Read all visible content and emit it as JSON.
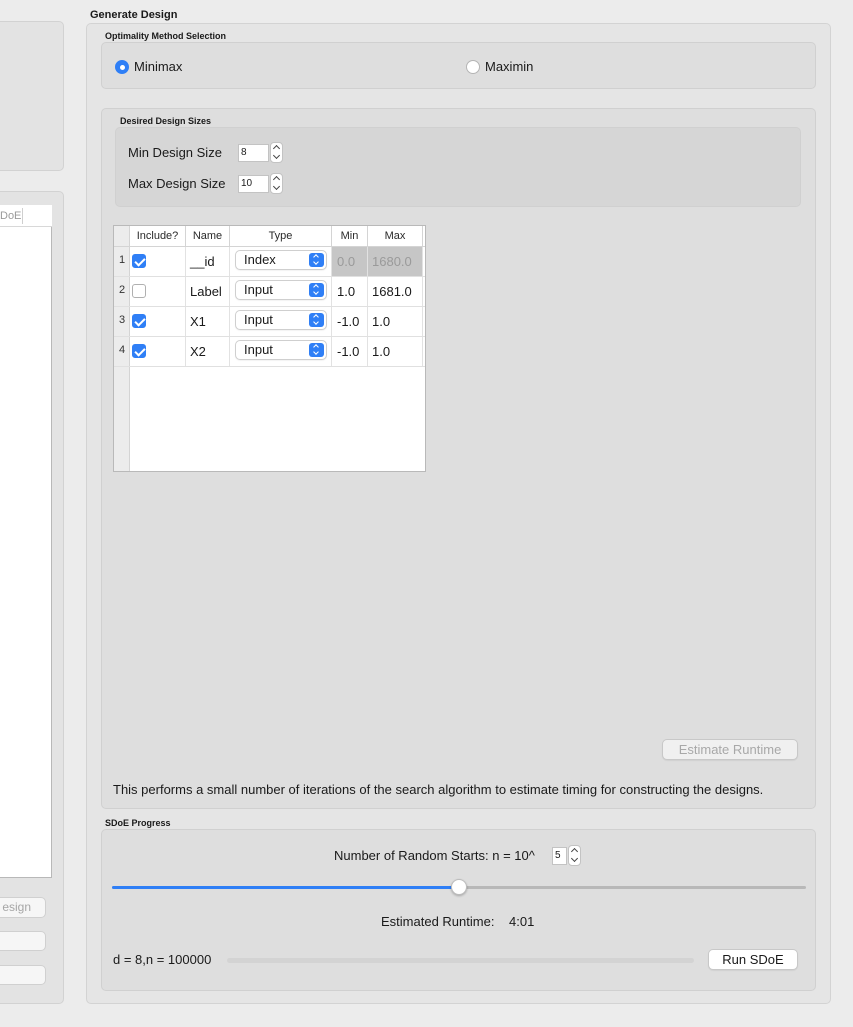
{
  "left_panel": {
    "list_column_fragment": "DoE",
    "button_fragment": "esign"
  },
  "generate_design": {
    "title": "Generate Design",
    "optimality": {
      "title": "Optimality Method Selection",
      "options": [
        {
          "label": "Minimax",
          "selected": true
        },
        {
          "label": "Maximin",
          "selected": false
        }
      ]
    },
    "sizes": {
      "title": "Desired Design Sizes",
      "min_label": "Min Design Size",
      "min_value": "8",
      "max_label": "Max Design Size",
      "max_value": "10"
    },
    "table": {
      "headers": [
        "Include?",
        "Name",
        "Type",
        "Min",
        "Max"
      ],
      "rows": [
        {
          "num": "1",
          "include": true,
          "name": "__id",
          "type": "Index",
          "min": "0.0",
          "max": "1680.0",
          "disabled": true
        },
        {
          "num": "2",
          "include": false,
          "name": "Label",
          "type": "Input",
          "min": "1.0",
          "max": "1681.0",
          "disabled": false
        },
        {
          "num": "3",
          "include": true,
          "name": "X1",
          "type": "Input",
          "min": "-1.0",
          "max": "1.0",
          "disabled": false
        },
        {
          "num": "4",
          "include": true,
          "name": "X2",
          "type": "Input",
          "min": "-1.0",
          "max": "1.0",
          "disabled": false
        }
      ]
    },
    "estimate_button": "Estimate Runtime",
    "estimate_description": "This performs a small number of iterations of the search algorithm to estimate timing for constructing the designs."
  },
  "progress": {
    "title": "SDoE Progress",
    "random_starts_label": "Number of Random Starts: n = 10^",
    "random_starts_value": "5",
    "slider_fraction": 0.5,
    "runtime_label": "Estimated Runtime:",
    "runtime_value": "4:01",
    "status_text": "d = 8,n = 100000",
    "progress_fraction": 0,
    "run_button": "Run SDoE"
  },
  "colors": {
    "accent": "#2f7ff6"
  }
}
